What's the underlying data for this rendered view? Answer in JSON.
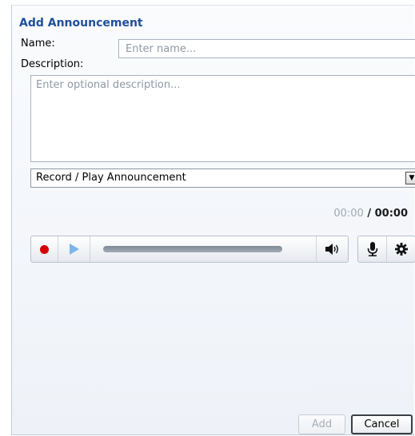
{
  "dialog": {
    "title": "Add Announcement",
    "name_label": "Name:",
    "name_placeholder": "Enter name...",
    "name_value": "",
    "description_label": "Description:",
    "description_placeholder": "Enter optional description...",
    "description_value": ""
  },
  "select": {
    "selected": "Record / Play Announcement",
    "arrow_icon": "chevron-down-icon"
  },
  "timer": {
    "current": "00:00",
    "separator": " / ",
    "total": "00:00"
  },
  "player": {
    "record_icon": "record-icon",
    "play_icon": "play-icon",
    "volume_icon": "volume-icon",
    "progress": 0,
    "record_color": "#d40000",
    "play_color": "#7ab6ea"
  },
  "tools": {
    "mic_icon": "microphone-icon",
    "settings_icon": "gear-icon"
  },
  "buttons": {
    "add_label": "Add",
    "cancel_label": "Cancel"
  },
  "colors": {
    "title": "#1f4f9a",
    "placeholder": "#8f98a3"
  }
}
